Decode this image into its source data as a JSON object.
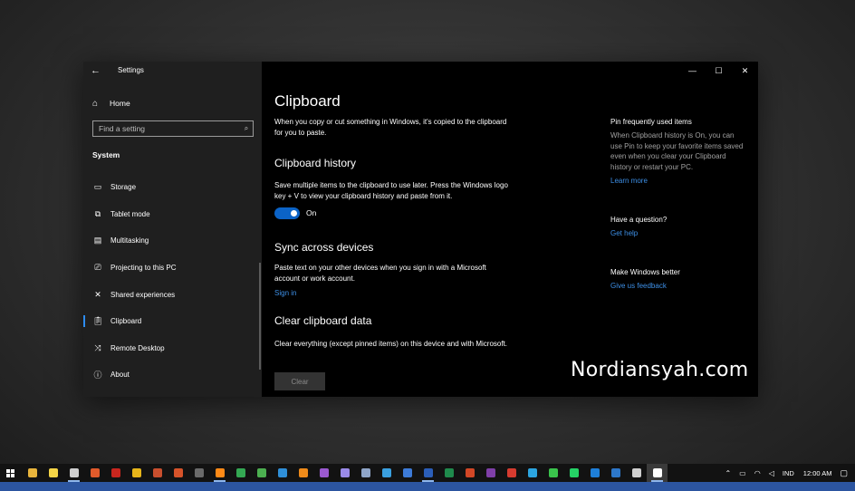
{
  "window": {
    "title": "Settings",
    "back_icon": "back-arrow-icon"
  },
  "sidebar": {
    "home": {
      "label": "Home",
      "icon": "home-icon"
    },
    "search": {
      "placeholder": "Find a setting",
      "icon": "search-icon"
    },
    "section": "System",
    "items": [
      {
        "label": "Storage",
        "icon": "storage-icon",
        "active": false
      },
      {
        "label": "Tablet mode",
        "icon": "tablet-mode-icon",
        "active": false
      },
      {
        "label": "Multitasking",
        "icon": "multitasking-icon",
        "active": false
      },
      {
        "label": "Projecting to this PC",
        "icon": "projecting-icon",
        "active": false
      },
      {
        "label": "Shared experiences",
        "icon": "shared-experiences-icon",
        "active": false
      },
      {
        "label": "Clipboard",
        "icon": "clipboard-icon",
        "active": true
      },
      {
        "label": "Remote Desktop",
        "icon": "remote-desktop-icon",
        "active": false
      },
      {
        "label": "About",
        "icon": "about-icon",
        "active": false
      }
    ]
  },
  "controls": {
    "minimize": "—",
    "maximize": "☐",
    "close": "✕"
  },
  "main": {
    "title": "Clipboard",
    "intro": "When you copy or cut something in Windows, it's copied to the clipboard for you to paste.",
    "history": {
      "heading": "Clipboard history",
      "description": "Save multiple items to the clipboard to use later. Press the Windows logo key + V to view your clipboard history and paste from it.",
      "toggle_on": true,
      "toggle_label": "On"
    },
    "sync": {
      "heading": "Sync across devices",
      "description": "Paste text on your other devices when you sign in with a Microsoft account or work account.",
      "link": "Sign in"
    },
    "clear": {
      "heading": "Clear clipboard data",
      "description": "Clear everything (except pinned items) on this device and with Microsoft.",
      "button": "Clear"
    }
  },
  "right": {
    "pin": {
      "heading": "Pin frequently used items",
      "text": "When Clipboard history is On, you can use Pin to keep your favorite items saved even when you clear your Clipboard history or restart your PC.",
      "link": "Learn more"
    },
    "question": {
      "heading": "Have a question?",
      "link": "Get help"
    },
    "better": {
      "heading": "Make Windows better",
      "link": "Give us feedback"
    }
  },
  "watermark": "Nordiansyah.com",
  "taskbar": {
    "apps": [
      {
        "name": "file-explorer-icon",
        "color": "#e8b43c",
        "running": false
      },
      {
        "name": "sticky-notes-icon",
        "color": "#f5d547",
        "running": false
      },
      {
        "name": "calculator-icon",
        "color": "#cfcfcf",
        "running": true
      },
      {
        "name": "tool-icon",
        "color": "#e05a2b",
        "running": false
      },
      {
        "name": "filezilla-icon",
        "color": "#c8261e",
        "running": false
      },
      {
        "name": "winamp-icon",
        "color": "#e7b51a",
        "running": false
      },
      {
        "name": "recorder-icon",
        "color": "#c94f2e",
        "running": false
      },
      {
        "name": "media-icon",
        "color": "#d6532a",
        "running": false
      },
      {
        "name": "archive-icon",
        "color": "#6a6a6a",
        "running": false
      },
      {
        "name": "firefox-icon",
        "color": "#ff8a17",
        "running": true
      },
      {
        "name": "chrome-icon",
        "color": "#34a853",
        "running": false
      },
      {
        "name": "corel-icon",
        "color": "#4caf50",
        "running": false
      },
      {
        "name": "photoshop-icon",
        "color": "#2f8fd8",
        "running": false
      },
      {
        "name": "illustrator-icon",
        "color": "#ee8a1a",
        "running": false
      },
      {
        "name": "premiere-icon",
        "color": "#9b59d0",
        "running": false
      },
      {
        "name": "after-effects-icon",
        "color": "#9a8ae8",
        "running": false
      },
      {
        "name": "app-icon",
        "color": "#8fa5c8",
        "running": false
      },
      {
        "name": "installer-icon",
        "color": "#3aa0e0",
        "running": false
      },
      {
        "name": "network-icon",
        "color": "#3d7bd8",
        "running": false
      },
      {
        "name": "word-icon",
        "color": "#2b5eb8",
        "running": true
      },
      {
        "name": "excel-icon",
        "color": "#1f8a4c",
        "running": false
      },
      {
        "name": "powerpoint-icon",
        "color": "#d24726",
        "running": false
      },
      {
        "name": "onenote-icon",
        "color": "#7f3fa8",
        "running": false
      },
      {
        "name": "pdf-icon",
        "color": "#d63b2f",
        "running": false
      },
      {
        "name": "telegram-icon",
        "color": "#2ca5e0",
        "running": false
      },
      {
        "name": "line-icon",
        "color": "#3ac34c",
        "running": false
      },
      {
        "name": "whatsapp-icon",
        "color": "#25d366",
        "running": false
      },
      {
        "name": "teamviewer-icon",
        "color": "#1e7fd9",
        "running": false
      },
      {
        "name": "cloud-icon",
        "color": "#2d77c9",
        "running": false
      },
      {
        "name": "photos-icon",
        "color": "#cfcfcf",
        "running": false
      },
      {
        "name": "settings-icon",
        "color": "#ffffff",
        "running": true,
        "focused": true
      }
    ],
    "tray": {
      "language": "IND",
      "time": "12:00 AM"
    }
  }
}
